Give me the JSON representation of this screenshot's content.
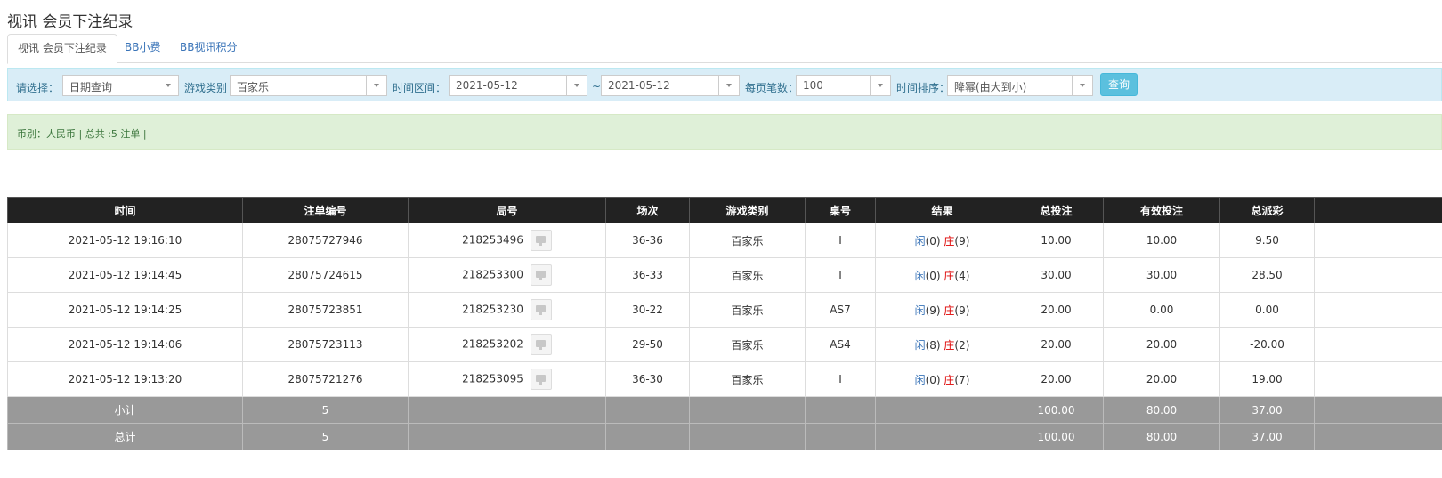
{
  "page_title": "视讯 会员下注纪录",
  "tabs": [
    {
      "label": "视讯 会员下注纪录",
      "active": true
    },
    {
      "label": "BB小费",
      "active": false
    },
    {
      "label": "BB视讯积分",
      "active": false
    }
  ],
  "filters": {
    "select_label": "请选择：",
    "select_value": "日期查询",
    "game_type_label": "游戏类别",
    "game_type_value": "百家乐",
    "time_range_label": "时间区间：",
    "date_from": "2021-05-12",
    "tilde": "~",
    "date_to": "2021-05-12",
    "per_page_label": "每页笔数：",
    "per_page_value": "100",
    "sort_label": "时间排序：",
    "sort_value": "降幂(由大到小)",
    "search_button": "查询"
  },
  "summary_text": "币别：人民币 | 总共 :5 注单 |",
  "table": {
    "headers": [
      "时间",
      "注单编号",
      "局号",
      "场次",
      "游戏类别",
      "桌号",
      "结果",
      "总投注",
      "有效投注",
      "总派彩",
      ""
    ],
    "rows": [
      {
        "time": "2021-05-12 19:16:10",
        "bet_no": "28075727946",
        "round_no": "218253496",
        "session": "36-36",
        "game": "百家乐",
        "table": "I",
        "xian": "闲",
        "xian_val": "(0)",
        "zhuang": "庄",
        "zhuang_val": "(9)",
        "total_bet": "10.00",
        "valid_bet": "10.00",
        "payout": "9.50"
      },
      {
        "time": "2021-05-12 19:14:45",
        "bet_no": "28075724615",
        "round_no": "218253300",
        "session": "36-33",
        "game": "百家乐",
        "table": "I",
        "xian": "闲",
        "xian_val": "(0)",
        "zhuang": "庄",
        "zhuang_val": "(4)",
        "total_bet": "30.00",
        "valid_bet": "30.00",
        "payout": "28.50"
      },
      {
        "time": "2021-05-12 19:14:25",
        "bet_no": "28075723851",
        "round_no": "218253230",
        "session": "30-22",
        "game": "百家乐",
        "table": "AS7",
        "xian": "闲",
        "xian_val": "(9)",
        "zhuang": "庄",
        "zhuang_val": "(9)",
        "total_bet": "20.00",
        "valid_bet": "0.00",
        "payout": "0.00"
      },
      {
        "time": "2021-05-12 19:14:06",
        "bet_no": "28075723113",
        "round_no": "218253202",
        "session": "29-50",
        "game": "百家乐",
        "table": "AS4",
        "xian": "闲",
        "xian_val": "(8)",
        "zhuang": "庄",
        "zhuang_val": "(2)",
        "total_bet": "20.00",
        "valid_bet": "20.00",
        "payout": "-20.00",
        "payout_negative": true
      },
      {
        "time": "2021-05-12 19:13:20",
        "bet_no": "28075721276",
        "round_no": "218253095",
        "session": "36-30",
        "game": "百家乐",
        "table": "I",
        "xian": "闲",
        "xian_val": "(0)",
        "zhuang": "庄",
        "zhuang_val": "(7)",
        "total_bet": "20.00",
        "valid_bet": "20.00",
        "payout": "19.00"
      }
    ],
    "subtotal": {
      "label": "小计",
      "count": "5",
      "total_bet": "100.00",
      "valid_bet": "80.00",
      "payout": "37.00"
    },
    "grand_total": {
      "label": "总计",
      "count": "5",
      "total_bet": "100.00",
      "valid_bet": "80.00",
      "payout": "37.00"
    }
  },
  "colors": {
    "accent_blue": "#3a74b8",
    "negative_red": "#dd0000",
    "header_bg": "#222222",
    "total_bg": "#999999"
  }
}
